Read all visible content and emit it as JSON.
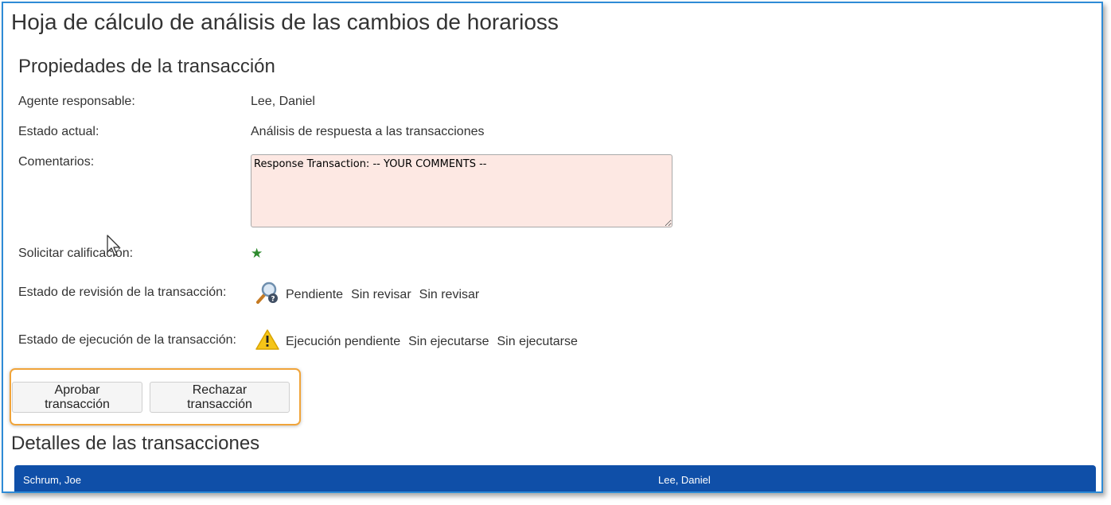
{
  "page": {
    "title": "Hoja de cálculo de análisis de las cambios de horarioss"
  },
  "properties": {
    "title": "Propiedades de la transacción",
    "agent_label": "Agente responsable:",
    "agent_value": "Lee, Daniel",
    "state_label": "Estado actual:",
    "state_value": "Análisis de respuesta a las transacciones",
    "comments_label": "Comentarios:",
    "comments_value": "Response Transaction: -- YOUR COMMENTS --",
    "rating_label": "Solicitar calificación:",
    "review_label": "Estado de revisión de la transacción:",
    "review_values": [
      "Pendiente",
      "Sin revisar",
      "Sin revisar"
    ],
    "exec_label": "Estado de ejecución de la transacción:",
    "exec_values": [
      "Ejecución pendiente",
      "Sin ejecutarse",
      "Sin ejecutarse"
    ]
  },
  "actions": {
    "approve_label": "Aprobar transacción",
    "reject_label": "Rechazar transacción"
  },
  "details": {
    "title": "Detalles de las transacciones",
    "columns": [
      "Schrum, Joe",
      "Lee, Daniel"
    ]
  },
  "colors": {
    "header_blue": "#0f4fa8",
    "comments_bg": "#fde8e3",
    "highlight_orange": "#f0a43a",
    "star_green": "#2e8b2e"
  },
  "icons": [
    "star-icon",
    "magnifier-question-icon",
    "warning-icon",
    "mouse-cursor-icon"
  ]
}
